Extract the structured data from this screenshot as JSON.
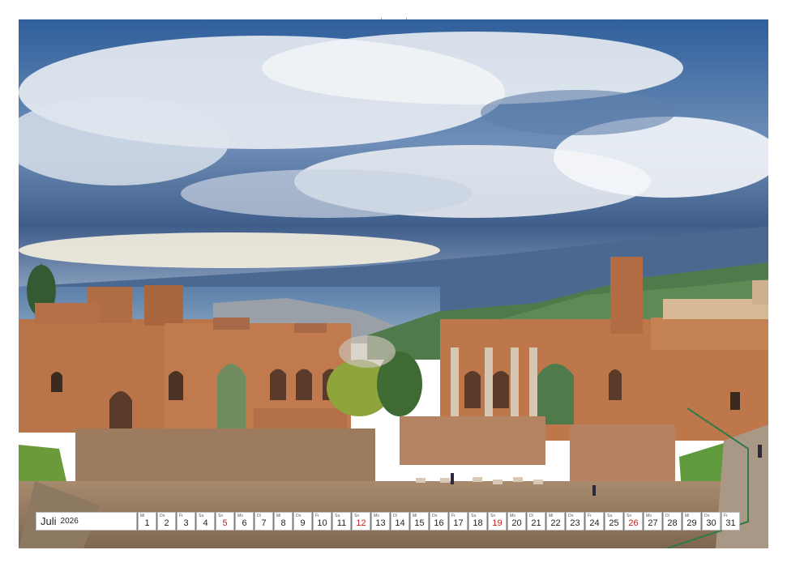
{
  "calendar": {
    "month": "Juli",
    "year": "2026",
    "days": [
      {
        "wd": "Mi",
        "n": "1"
      },
      {
        "wd": "Do",
        "n": "2"
      },
      {
        "wd": "Fr",
        "n": "3"
      },
      {
        "wd": "Sa",
        "n": "4"
      },
      {
        "wd": "So",
        "n": "5"
      },
      {
        "wd": "Mo",
        "n": "6"
      },
      {
        "wd": "Di",
        "n": "7"
      },
      {
        "wd": "Mi",
        "n": "8"
      },
      {
        "wd": "Do",
        "n": "9"
      },
      {
        "wd": "Fr",
        "n": "10"
      },
      {
        "wd": "Sa",
        "n": "11"
      },
      {
        "wd": "So",
        "n": "12"
      },
      {
        "wd": "Mo",
        "n": "13"
      },
      {
        "wd": "Di",
        "n": "14"
      },
      {
        "wd": "Mi",
        "n": "15"
      },
      {
        "wd": "Do",
        "n": "16"
      },
      {
        "wd": "Fr",
        "n": "17"
      },
      {
        "wd": "Sa",
        "n": "18"
      },
      {
        "wd": "So",
        "n": "19"
      },
      {
        "wd": "Mo",
        "n": "20"
      },
      {
        "wd": "Di",
        "n": "21"
      },
      {
        "wd": "Mi",
        "n": "22"
      },
      {
        "wd": "Do",
        "n": "23"
      },
      {
        "wd": "Fr",
        "n": "24"
      },
      {
        "wd": "Sa",
        "n": "25"
      },
      {
        "wd": "So",
        "n": "26"
      },
      {
        "wd": "Mo",
        "n": "27"
      },
      {
        "wd": "Di",
        "n": "28"
      },
      {
        "wd": "Mi",
        "n": "29"
      },
      {
        "wd": "Do",
        "n": "30"
      },
      {
        "wd": "Fr",
        "n": "31"
      }
    ]
  },
  "colors": {
    "sunday": "#c1201e",
    "sky_top": "#2f5f9c",
    "stone": "#c07a4e"
  }
}
